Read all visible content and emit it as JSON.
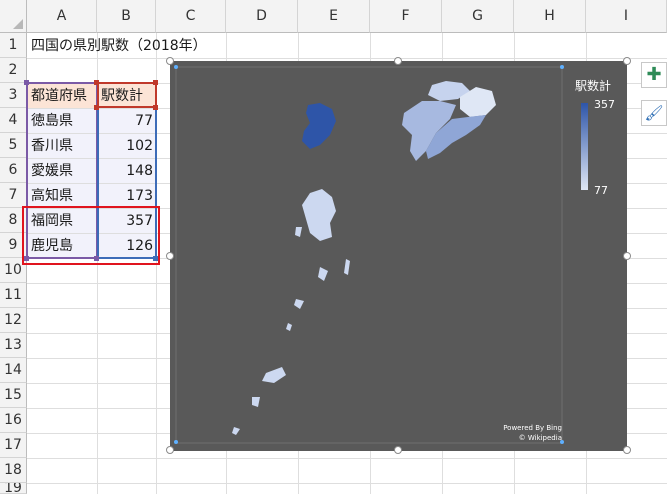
{
  "columns": [
    "A",
    "B",
    "C",
    "D",
    "E",
    "F",
    "G",
    "H",
    "I"
  ],
  "rows": [
    "1",
    "2",
    "3",
    "4",
    "5",
    "6",
    "7",
    "8",
    "9",
    "10",
    "11",
    "12",
    "13",
    "14",
    "15",
    "16",
    "17",
    "18",
    "19"
  ],
  "title_cell": "四国の県別駅数（2018年）",
  "table": {
    "headers": [
      "都道府県",
      "駅数計"
    ],
    "rows": [
      {
        "name": "徳島県",
        "value": "77"
      },
      {
        "name": "香川県",
        "value": "102"
      },
      {
        "name": "愛媛県",
        "value": "148"
      },
      {
        "name": "高知県",
        "value": "173"
      },
      {
        "name": "福岡県",
        "value": "357"
      },
      {
        "name": "鹿児島",
        "value": "126"
      }
    ]
  },
  "chart": {
    "legend_title": "駅数計",
    "legend_max": "357",
    "legend_min": "77",
    "credit_line1": "Powered By Bing",
    "credit_line2": "© Wikipedia",
    "background_color": "#595959",
    "max_color": "#2e55a8",
    "min_color": "#dfe7f5"
  },
  "side_buttons": {
    "add_icon": "plus-icon",
    "style_icon": "brush-icon"
  }
}
